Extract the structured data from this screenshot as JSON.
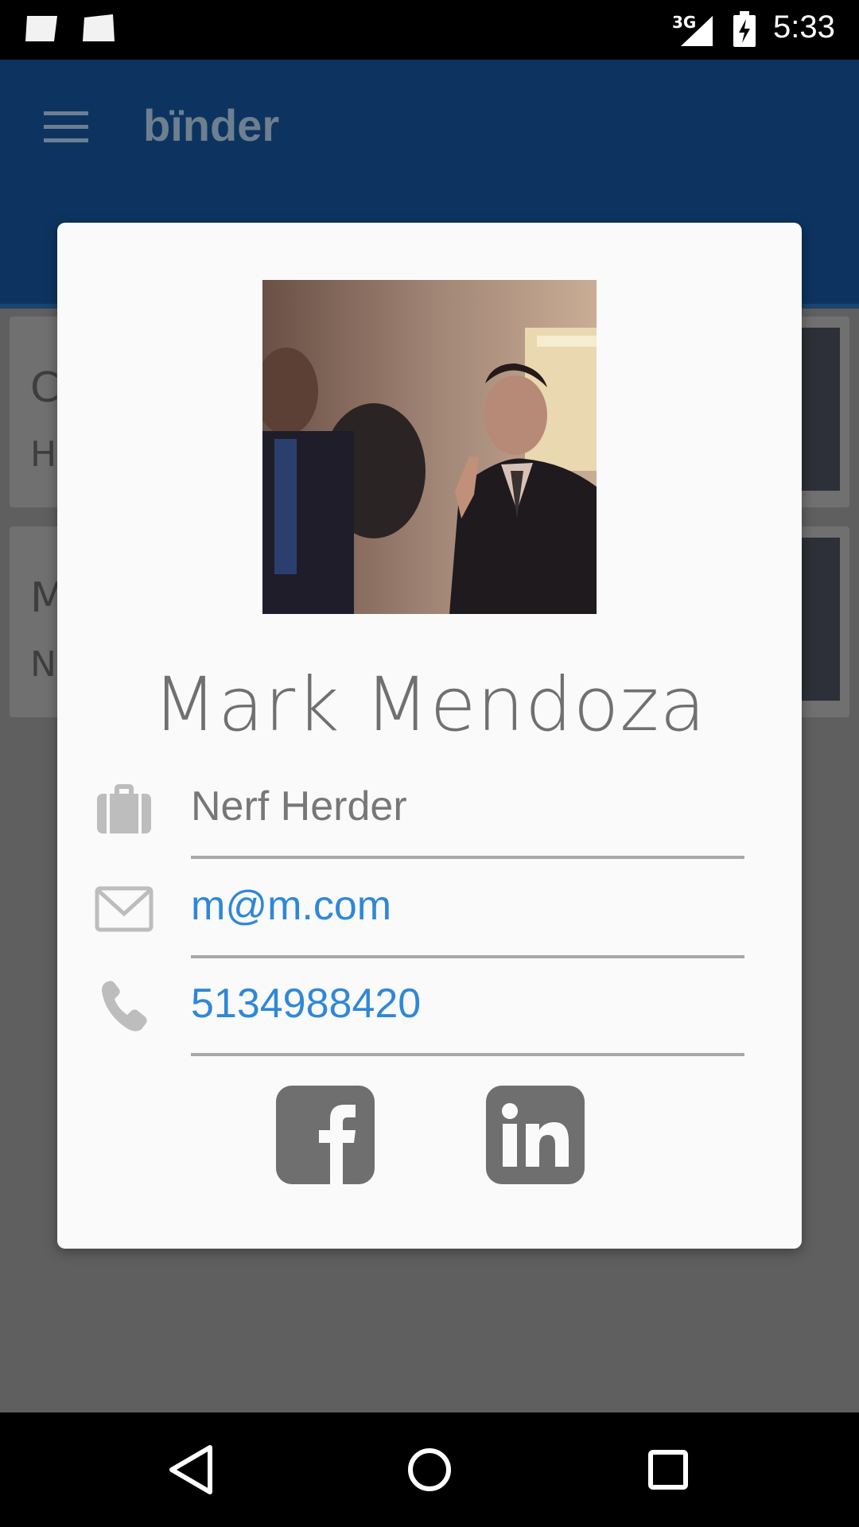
{
  "status_bar": {
    "network": "3G",
    "time": "5:33"
  },
  "app": {
    "title": "bïnder"
  },
  "background_cards": [
    {
      "line1": "C",
      "line2": "H"
    },
    {
      "line1": "M",
      "line2": "N"
    }
  ],
  "profile": {
    "name": "Mark Mendoza",
    "job": "Nerf Herder",
    "email": "m@m.com",
    "phone": "5134988420"
  },
  "social": [
    {
      "icon": "facebook-icon"
    },
    {
      "icon": "linkedin-icon"
    }
  ],
  "colors": {
    "link": "#2f88d6",
    "appbar": "#0d3460",
    "icon_gray": "#6f6f6f"
  }
}
